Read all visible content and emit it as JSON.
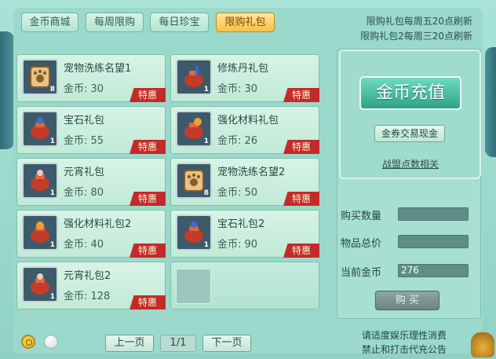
{
  "tabs": [
    {
      "label": "金币商城"
    },
    {
      "label": "每周限购"
    },
    {
      "label": "每日珍宝"
    },
    {
      "label": "限购礼包"
    }
  ],
  "notice": {
    "line1": "限购礼包每周五20点刷新",
    "line2": "限购礼包2每周三20点刷新"
  },
  "items": [
    {
      "name": "宠物洗练名望1",
      "price": "金币: 30",
      "qty": "8",
      "badge": "特惠"
    },
    {
      "name": "修炼丹礼包",
      "price": "金币: 30",
      "qty": "1",
      "badge": "特惠"
    },
    {
      "name": "宝石礼包",
      "price": "金币: 55",
      "qty": "1",
      "badge": "特惠"
    },
    {
      "name": "强化材料礼包",
      "price": "金币: 26",
      "qty": "1",
      "badge": "特惠"
    },
    {
      "name": "元宵礼包",
      "price": "金币: 80",
      "qty": "1",
      "badge": "特惠"
    },
    {
      "name": "宠物洗练名望2",
      "price": "金币: 50",
      "qty": "8",
      "badge": "特惠"
    },
    {
      "name": "强化材料礼包2",
      "price": "金币: 40",
      "qty": "1",
      "badge": "特惠"
    },
    {
      "name": "宝石礼包2",
      "price": "金币: 90",
      "qty": "1",
      "badge": "特惠"
    },
    {
      "name": "元宵礼包2",
      "price": "金币: 128",
      "qty": "1",
      "badge": "特惠"
    }
  ],
  "side": {
    "recharge_label": "金币充值",
    "exchange_label": "金券交易现金",
    "alliance_label": "战盟点数相关",
    "buy_qty_label": "购买数量",
    "buy_qty_value": "",
    "total_label": "物品总价",
    "total_value": "",
    "current_gold_label": "当前金币",
    "current_gold_value": "276",
    "buy_label": "购 买"
  },
  "pager": {
    "prev_label": "上一页",
    "page_label": "1/1",
    "next_label": "下一页"
  },
  "footer": {
    "line1": "请适度娱乐理性消费",
    "line2": "禁止和打击代充公告"
  },
  "colors": {
    "accent_tab": "#f5c14a",
    "sale_badge": "#c42a2a",
    "recharge_button": "#2da386"
  }
}
